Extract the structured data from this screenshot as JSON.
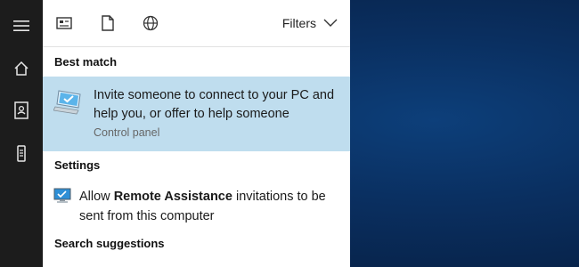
{
  "topbar": {
    "filters_label": "Filters"
  },
  "sections": {
    "best_match": "Best match",
    "settings": "Settings",
    "search_suggestions": "Search suggestions"
  },
  "best_match_result": {
    "title": "Invite someone to connect to your PC and help you, or offer to help someone",
    "subtitle": "Control panel"
  },
  "settings_result": {
    "prefix": "Allow ",
    "bold": "Remote Assistance",
    "suffix": " invitations to be sent from this computer"
  },
  "colors": {
    "rail_bg": "#1c1c1c",
    "selected_bg": "#bfddee",
    "desktop_bg": "#0a2f60"
  },
  "icons": {
    "rail": [
      "hamburger-menu-icon",
      "home-icon",
      "notebook-icon",
      "device-icon"
    ],
    "topbar": [
      "apps-icon",
      "documents-icon",
      "web-icon",
      "chevron-down-icon"
    ],
    "results": [
      "remote-assistance-monitor-icon",
      "monitor-settings-icon"
    ]
  }
}
